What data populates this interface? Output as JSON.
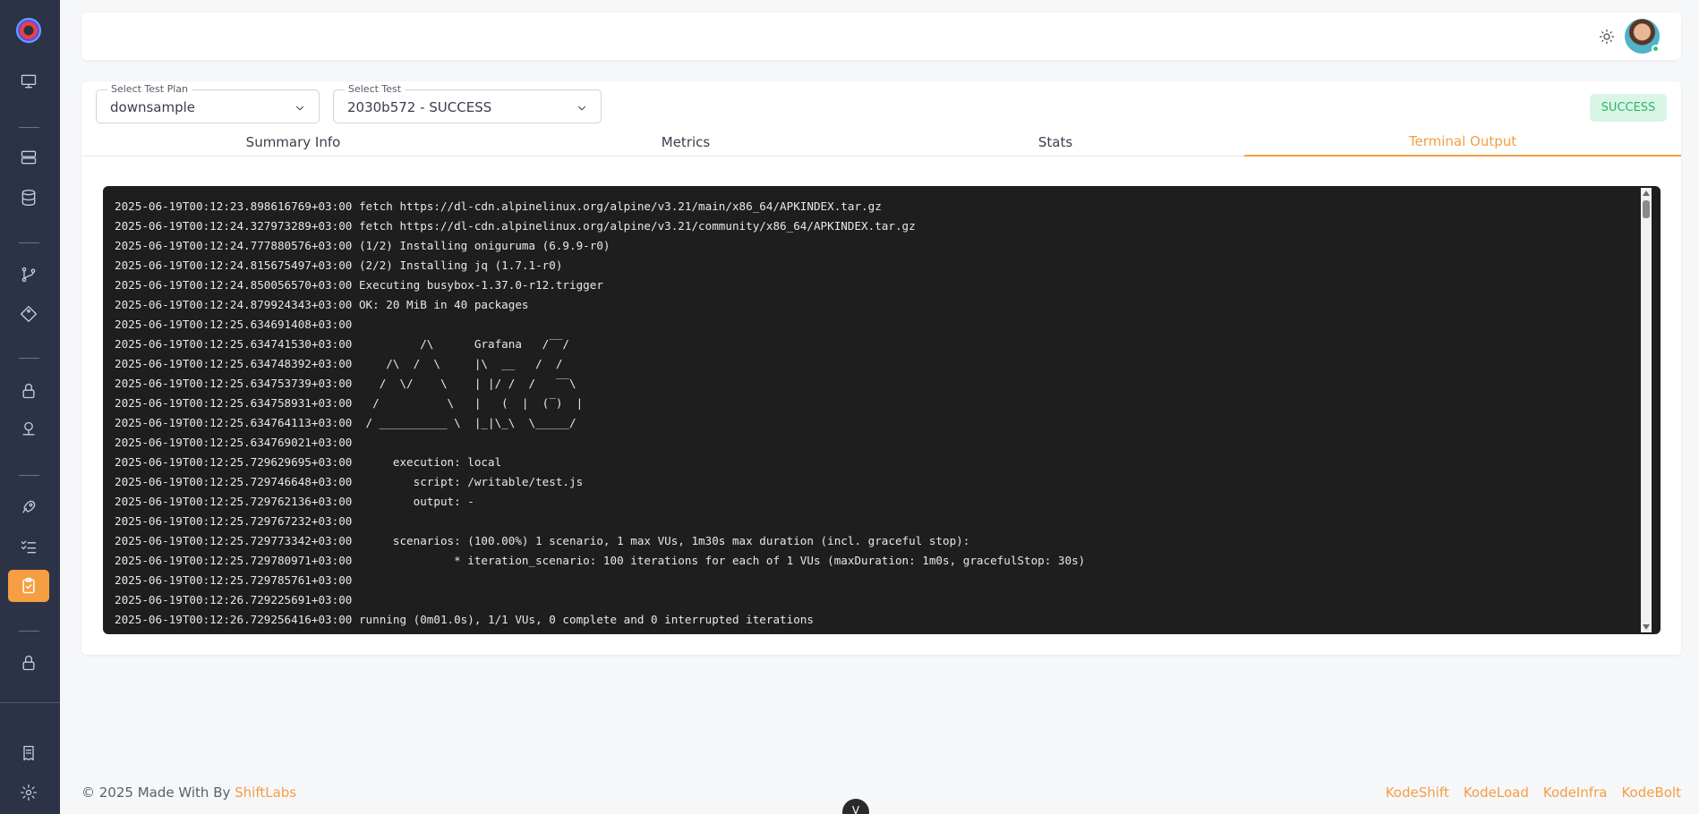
{
  "sidebar": {
    "icons": [
      "monitor-icon",
      "server-icon",
      "database-icon",
      "git-branch-icon",
      "tag-icon",
      "lock-icon",
      "network-icon",
      "rocket-icon",
      "checklist-icon",
      "clipboard-icon",
      "lock-icon",
      "receipt-icon",
      "gear-icon"
    ],
    "active": "clipboard-icon",
    "accent_color": "#f59e42",
    "background_color": "#2c3347"
  },
  "filters": {
    "test_plan_label": "Select Test Plan",
    "test_plan_value": "downsample",
    "test_label": "Select Test",
    "test_value": "2030b572 - SUCCESS"
  },
  "status_badge": "SUCCESS",
  "tabs": [
    {
      "label": "Summary Info"
    },
    {
      "label": "Metrics"
    },
    {
      "label": "Stats"
    },
    {
      "label": "Terminal Output"
    }
  ],
  "active_tab": "Terminal Output",
  "terminal": {
    "lines": [
      "2025-06-19T00:12:23.898616769+03:00 fetch https://dl-cdn.alpinelinux.org/alpine/v3.21/main/x86_64/APKINDEX.tar.gz",
      "2025-06-19T00:12:24.327973289+03:00 fetch https://dl-cdn.alpinelinux.org/alpine/v3.21/community/x86_64/APKINDEX.tar.gz",
      "2025-06-19T00:12:24.777880576+03:00 (1/2) Installing oniguruma (6.9.9-r0)",
      "2025-06-19T00:12:24.815675497+03:00 (2/2) Installing jq (1.7.1-r0)",
      "2025-06-19T00:12:24.850056570+03:00 Executing busybox-1.37.0-r12.trigger",
      "2025-06-19T00:12:24.879924343+03:00 OK: 20 MiB in 40 packages",
      "2025-06-19T00:12:25.634691408+03:00",
      "2025-06-19T00:12:25.634741530+03:00          /\\      Grafana   /‾‾/",
      "2025-06-19T00:12:25.634748392+03:00     /\\  /  \\     |\\  __   /  /",
      "2025-06-19T00:12:25.634753739+03:00    /  \\/    \\    | |/ /  /   ‾‾\\",
      "2025-06-19T00:12:25.634758931+03:00   /          \\   |   (  |  (‾)  |",
      "2025-06-19T00:12:25.634764113+03:00  / __________ \\  |_|\\_\\  \\_____/",
      "2025-06-19T00:12:25.634769021+03:00",
      "2025-06-19T00:12:25.729629695+03:00      execution: local",
      "2025-06-19T00:12:25.729746648+03:00         script: /writable/test.js",
      "2025-06-19T00:12:25.729762136+03:00         output: -",
      "2025-06-19T00:12:25.729767232+03:00",
      "2025-06-19T00:12:25.729773342+03:00      scenarios: (100.00%) 1 scenario, 1 max VUs, 1m30s max duration (incl. graceful stop):",
      "2025-06-19T00:12:25.729780971+03:00               * iteration_scenario: 100 iterations for each of 1 VUs (maxDuration: 1m0s, gracefulStop: 30s)",
      "2025-06-19T00:12:25.729785761+03:00",
      "2025-06-19T00:12:26.729225691+03:00",
      "2025-06-19T00:12:26.729256416+03:00 running (0m01.0s), 1/1 VUs, 0 complete and 0 interrupted iterations"
    ]
  },
  "footer": {
    "copyright": "© 2025 Made With By ",
    "brand": "ShiftLabs",
    "links": [
      "KodeShift",
      "KodeLoad",
      "KodeInfra",
      "KodeBolt"
    ]
  },
  "float_button_label": "V"
}
